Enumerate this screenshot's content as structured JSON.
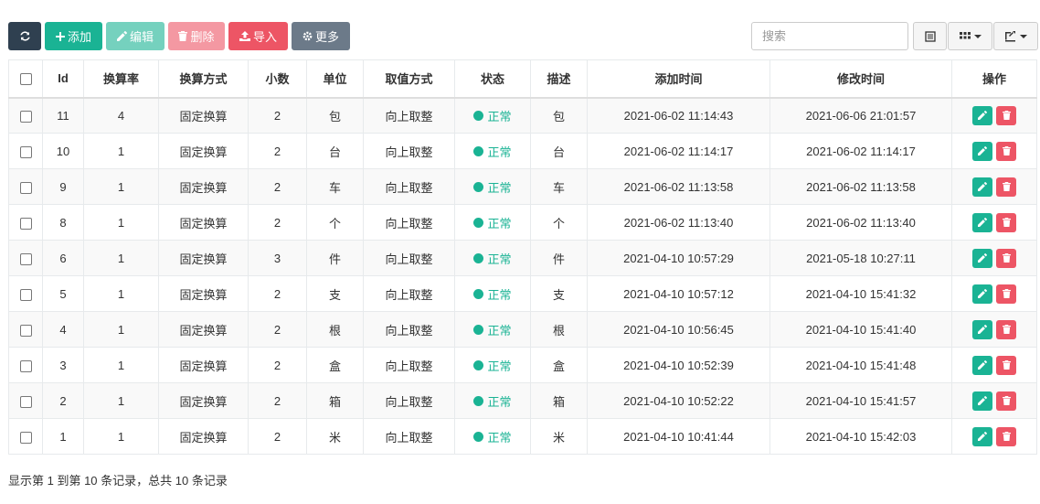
{
  "toolbar": {
    "refresh_icon": "refresh-icon",
    "add_label": "添加",
    "edit_label": "编辑",
    "delete_label": "删除",
    "import_label": "导入",
    "more_label": "更多"
  },
  "search": {
    "placeholder": "搜索",
    "value": ""
  },
  "right_tools": {
    "toggle_icon": "list-icon",
    "columns_icon": "grid-icon",
    "export_icon": "export-icon"
  },
  "table": {
    "headers": [
      "Id",
      "换算率",
      "换算方式",
      "小数",
      "单位",
      "取值方式",
      "状态",
      "描述",
      "添加时间",
      "修改时间",
      "操作"
    ],
    "rows": [
      {
        "id": "11",
        "rate": "4",
        "method": "固定换算",
        "decimals": "2",
        "unit": "包",
        "rounding": "向上取整",
        "status": "正常",
        "desc": "包",
        "created": "2021-06-02 11:14:43",
        "modified": "2021-06-06 21:01:57"
      },
      {
        "id": "10",
        "rate": "1",
        "method": "固定换算",
        "decimals": "2",
        "unit": "台",
        "rounding": "向上取整",
        "status": "正常",
        "desc": "台",
        "created": "2021-06-02 11:14:17",
        "modified": "2021-06-02 11:14:17"
      },
      {
        "id": "9",
        "rate": "1",
        "method": "固定换算",
        "decimals": "2",
        "unit": "车",
        "rounding": "向上取整",
        "status": "正常",
        "desc": "车",
        "created": "2021-06-02 11:13:58",
        "modified": "2021-06-02 11:13:58"
      },
      {
        "id": "8",
        "rate": "1",
        "method": "固定换算",
        "decimals": "2",
        "unit": "个",
        "rounding": "向上取整",
        "status": "正常",
        "desc": "个",
        "created": "2021-06-02 11:13:40",
        "modified": "2021-06-02 11:13:40"
      },
      {
        "id": "6",
        "rate": "1",
        "method": "固定换算",
        "decimals": "3",
        "unit": "件",
        "rounding": "向上取整",
        "status": "正常",
        "desc": "件",
        "created": "2021-04-10 10:57:29",
        "modified": "2021-05-18 10:27:11"
      },
      {
        "id": "5",
        "rate": "1",
        "method": "固定换算",
        "decimals": "2",
        "unit": "支",
        "rounding": "向上取整",
        "status": "正常",
        "desc": "支",
        "created": "2021-04-10 10:57:12",
        "modified": "2021-04-10 15:41:32"
      },
      {
        "id": "4",
        "rate": "1",
        "method": "固定换算",
        "decimals": "2",
        "unit": "根",
        "rounding": "向上取整",
        "status": "正常",
        "desc": "根",
        "created": "2021-04-10 10:56:45",
        "modified": "2021-04-10 15:41:40"
      },
      {
        "id": "3",
        "rate": "1",
        "method": "固定换算",
        "decimals": "2",
        "unit": "盒",
        "rounding": "向上取整",
        "status": "正常",
        "desc": "盒",
        "created": "2021-04-10 10:52:39",
        "modified": "2021-04-10 15:41:48"
      },
      {
        "id": "2",
        "rate": "1",
        "method": "固定换算",
        "decimals": "2",
        "unit": "箱",
        "rounding": "向上取整",
        "status": "正常",
        "desc": "箱",
        "created": "2021-04-10 10:52:22",
        "modified": "2021-04-10 15:41:57"
      },
      {
        "id": "1",
        "rate": "1",
        "method": "固定换算",
        "decimals": "2",
        "unit": "米",
        "rounding": "向上取整",
        "status": "正常",
        "desc": "米",
        "created": "2021-04-10 10:41:44",
        "modified": "2021-04-10 15:42:03"
      }
    ]
  },
  "footer": {
    "text": "显示第 1 到第 10 条记录，总共 10 条记录"
  },
  "colors": {
    "primary_dark": "#2f4050",
    "success": "#1ab394",
    "danger": "#ed5565",
    "muted": "#6c7a89",
    "method_text": "#d9534f"
  }
}
